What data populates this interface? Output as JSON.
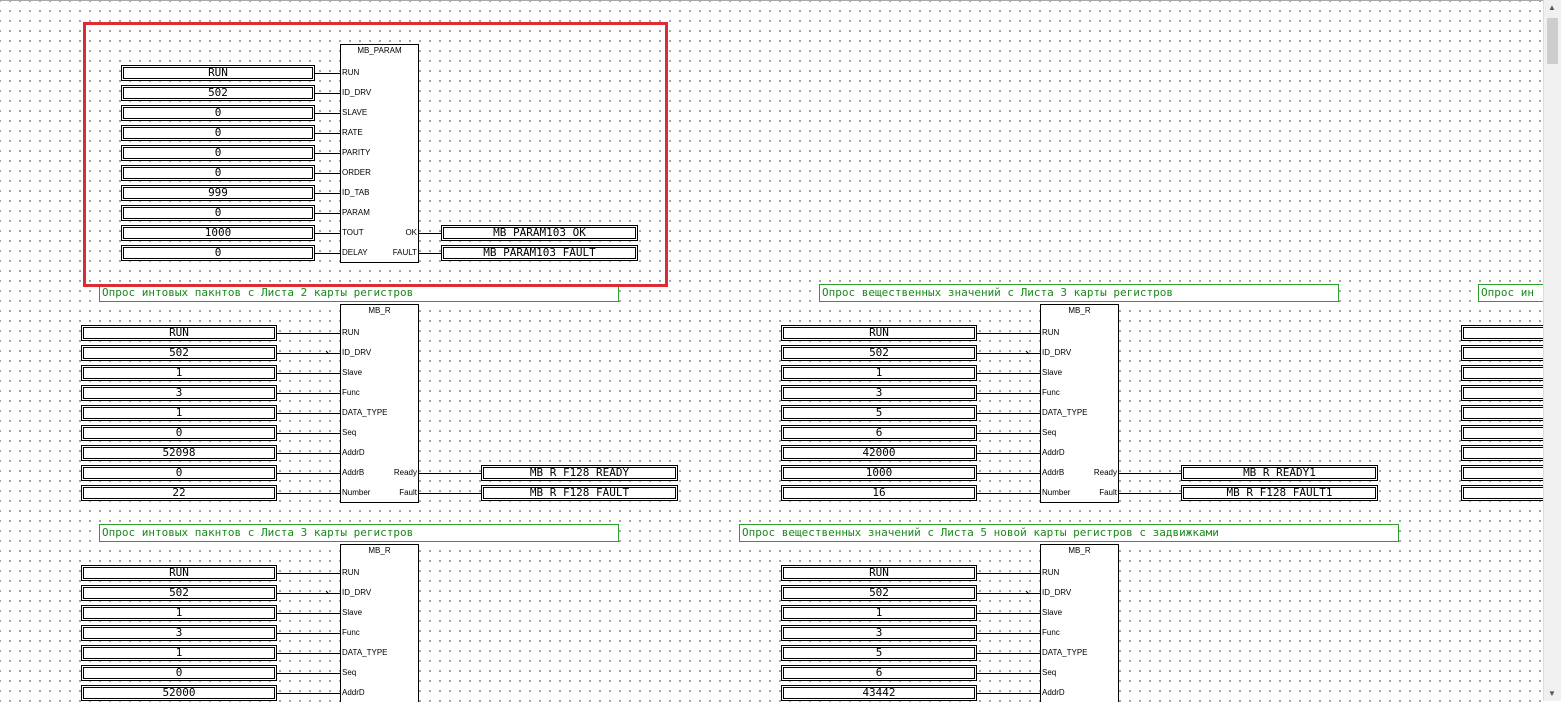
{
  "colors": {
    "selection": "#dc2b33",
    "comment_border": "#2aa02a",
    "comment_text": "#188a18",
    "grid_dot": "#7a7a7a"
  },
  "icons": {
    "scroll_up": "arrow-up-icon",
    "scroll_down": "arrow-down-icon"
  },
  "blocks": [
    {
      "title": "MB_PARAM",
      "inputs": [
        {
          "pin": "RUN",
          "value": "RUN"
        },
        {
          "pin": "ID_DRV",
          "value": "502"
        },
        {
          "pin": "SLAVE",
          "value": "0"
        },
        {
          "pin": "RATE",
          "value": "0"
        },
        {
          "pin": "PARITY",
          "value": "0"
        },
        {
          "pin": "ORDER",
          "value": "0"
        },
        {
          "pin": "ID_TAB",
          "value": "999"
        },
        {
          "pin": "PARAM",
          "value": "0"
        },
        {
          "pin": "TOUT",
          "value": "1000"
        },
        {
          "pin": "DELAY",
          "value": "0"
        }
      ],
      "outputs": [
        {
          "pin": "OK",
          "var": "MB_PARAM103_OK",
          "row": 8
        },
        {
          "pin": "FAULT",
          "var": "MB_PARAM103_FAULT",
          "row": 9
        }
      ]
    },
    {
      "title": "MB_R",
      "comment": "Опрос интовых пакнтов с Листа 2  карты регистров",
      "inputs": [
        {
          "pin": "RUN",
          "value": "RUN"
        },
        {
          "pin": "ID_DRV",
          "value": "502"
        },
        {
          "pin": "Slave",
          "value": "1"
        },
        {
          "pin": "Func",
          "value": "3"
        },
        {
          "pin": "DATA_TYPE",
          "value": "1"
        },
        {
          "pin": "Seq",
          "value": "0"
        },
        {
          "pin": "AddrD",
          "value": "52098"
        },
        {
          "pin": "AddrB",
          "value": "0"
        },
        {
          "pin": "Number",
          "value": "22"
        }
      ],
      "outputs": [
        {
          "pin": "Ready",
          "var": "MB_R_F128_READY",
          "row": 7
        },
        {
          "pin": "Fault",
          "var": "MB_R_F128_FAULT",
          "row": 8
        }
      ]
    },
    {
      "title": "MB_R",
      "comment": "Опрос вещественных значений с Листа 3  карты регистров",
      "inputs": [
        {
          "pin": "RUN",
          "value": "RUN"
        },
        {
          "pin": "ID_DRV",
          "value": "502"
        },
        {
          "pin": "Slave",
          "value": "1"
        },
        {
          "pin": "Func",
          "value": "3"
        },
        {
          "pin": "DATA_TYPE",
          "value": "5"
        },
        {
          "pin": "Seq",
          "value": "6"
        },
        {
          "pin": "AddrD",
          "value": "42000"
        },
        {
          "pin": "AddrB",
          "value": "1000"
        },
        {
          "pin": "Number",
          "value": "16"
        }
      ],
      "outputs": [
        {
          "pin": "Ready",
          "var": "MB_R_READY1",
          "row": 7
        },
        {
          "pin": "Fault",
          "var": "MB_R_F128_FAULT1",
          "row": 8
        }
      ]
    },
    {
      "title": "MB_R",
      "comment": "Опрос интовых пакнтов с Листа 3 карты регистров",
      "inputs": [
        {
          "pin": "RUN",
          "value": "RUN"
        },
        {
          "pin": "ID_DRV",
          "value": "502"
        },
        {
          "pin": "Slave",
          "value": "1"
        },
        {
          "pin": "Func",
          "value": "3"
        },
        {
          "pin": "DATA_TYPE",
          "value": "1"
        },
        {
          "pin": "Seq",
          "value": "0"
        },
        {
          "pin": "AddrD",
          "value": "52000"
        }
      ],
      "outputs": []
    },
    {
      "title": "MB_R",
      "comment": "Опрос вещественных значений с Листа 5 новой карты регистров с задвижками",
      "inputs": [
        {
          "pin": "RUN",
          "value": "RUN"
        },
        {
          "pin": "ID_DRV",
          "value": "502"
        },
        {
          "pin": "Slave",
          "value": "1"
        },
        {
          "pin": "Func",
          "value": "3"
        },
        {
          "pin": "DATA_TYPE",
          "value": "5"
        },
        {
          "pin": "Seq",
          "value": "6"
        },
        {
          "pin": "AddrD",
          "value": "43442"
        }
      ],
      "outputs": []
    }
  ],
  "partial_comment": "Опрос ин"
}
